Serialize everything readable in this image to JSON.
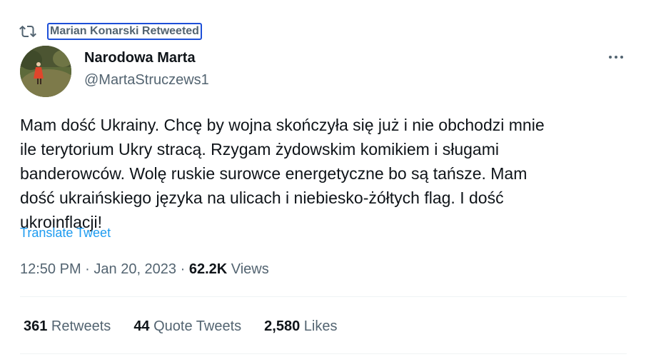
{
  "retweet_banner": {
    "icon": "retweet-icon",
    "label": "Marian Konarski Retweeted"
  },
  "author": {
    "display_name": "Narodowa Marta",
    "handle": "@MartaStruczews1",
    "avatar": "avatar-photo"
  },
  "tweet": {
    "text": "Mam dość Ukrainy. Chcę by wojna skończyła się już i nie obchodzi mnie\nile terytorium Ukry stracą. Rzygam żydowskim komikiem i sługami\nbanderowców. Wolę ruskie surowce energetyczne bo są tańsze. Mam\ndość ukraińskiego języka na ulicach i niebiesko-żółtych flag. I dość\nukroinflacji!",
    "translate_label": "Translate Tweet"
  },
  "meta": {
    "time": "12:50 PM",
    "separator": " · ",
    "date": "Jan 20, 2023",
    "views_count": "62.2K",
    "views_label": " Views"
  },
  "stats": {
    "retweets_count": "361",
    "retweets_label": " Retweets",
    "quotes_count": "44",
    "quotes_label": " Quote Tweets",
    "likes_count": "2,580",
    "likes_label": " Likes"
  },
  "colors": {
    "link": "#1d9bf0",
    "secondary_text": "#536471",
    "primary_text": "#0f1419",
    "focus_ring": "#1d4fd8"
  }
}
